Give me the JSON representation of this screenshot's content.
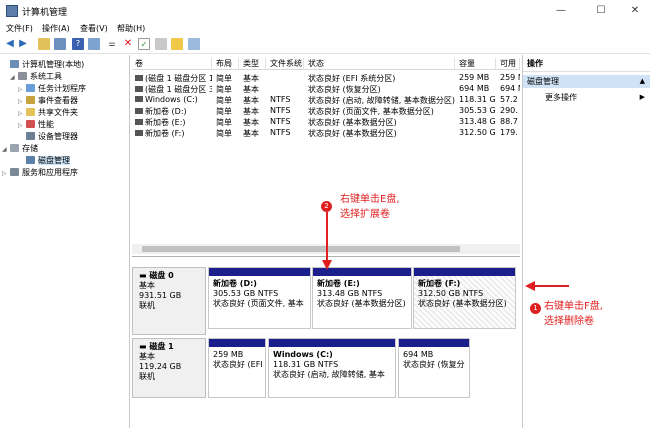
{
  "window": {
    "title": "计算机管理",
    "controls": {
      "minimize": "—",
      "maximize": "☐",
      "close": "✕"
    }
  },
  "menu": [
    "文件(F)",
    "操作(A)",
    "查看(V)",
    "帮助(H)"
  ],
  "tree": {
    "root": "计算机管理(本地)",
    "system_tools": "系统工具",
    "task_scheduler": "任务计划程序",
    "event_viewer": "事件查看器",
    "shared_folders": "共享文件夹",
    "performance": "性能",
    "device_manager": "设备管理器",
    "storage": "存储",
    "disk_management": "磁盘管理",
    "services": "服务和应用程序"
  },
  "columns": [
    "卷",
    "布局",
    "类型",
    "文件系统",
    "状态",
    "容量",
    "可用"
  ],
  "volumes": [
    {
      "name": "(磁盘 1 磁盘分区 1)",
      "layout": "简单",
      "type": "基本",
      "fs": "",
      "status": "状态良好 (EFI 系统分区)",
      "cap": "259 MB",
      "free": "259 MB"
    },
    {
      "name": "(磁盘 1 磁盘分区 3)",
      "layout": "简单",
      "type": "基本",
      "fs": "",
      "status": "状态良好 (恢复分区)",
      "cap": "694 MB",
      "free": "694 MB"
    },
    {
      "name": "Windows (C:)",
      "layout": "简单",
      "type": "基本",
      "fs": "NTFS",
      "status": "状态良好 (启动, 故障转储, 基本数据分区)",
      "cap": "118.31 GB",
      "free": "57.2"
    },
    {
      "name": "新加卷 (D:)",
      "layout": "简单",
      "type": "基本",
      "fs": "NTFS",
      "status": "状态良好 (页面文件, 基本数据分区)",
      "cap": "305.53 GB",
      "free": "290."
    },
    {
      "name": "新加卷 (E:)",
      "layout": "简单",
      "type": "基本",
      "fs": "NTFS",
      "status": "状态良好 (基本数据分区)",
      "cap": "313.48 GB",
      "free": "88.7"
    },
    {
      "name": "新加卷 (F:)",
      "layout": "简单",
      "type": "基本",
      "fs": "NTFS",
      "status": "状态良好 (基本数据分区)",
      "cap": "312.50 GB",
      "free": "179."
    }
  ],
  "disks": [
    {
      "name": "磁盘 0",
      "type": "基本",
      "size": "931.51 GB",
      "state": "联机",
      "partitions": [
        {
          "name": "新加卷 (D:)",
          "size": "305.53 GB NTFS",
          "status": "状态良好 (页面文件, 基本"
        },
        {
          "name": "新加卷 (E:)",
          "size": "313.48 GB NTFS",
          "status": "状态良好 (基本数据分区)"
        },
        {
          "name": "新加卷 (F:)",
          "size": "312.50 GB NTFS",
          "status": "状态良好 (基本数据分区)"
        }
      ]
    },
    {
      "name": "磁盘 1",
      "type": "基本",
      "size": "119.24 GB",
      "state": "联机",
      "partitions": [
        {
          "name": "",
          "size": "259 MB",
          "status": "状态良好 (EFI )"
        },
        {
          "name": "Windows (C:)",
          "size": "118.31 GB NTFS",
          "status": "状态良好 (启动, 故障转储, 基本"
        },
        {
          "name": "",
          "size": "694 MB",
          "status": "状态良好 (恢复分"
        }
      ]
    }
  ],
  "actions": {
    "header": "操作",
    "selected": "磁盘管理",
    "more": "更多操作"
  },
  "annotations": {
    "step2_line1": "右键单击E盘,",
    "step2_line2": "选择扩展卷",
    "step2_badge": "2",
    "step1_line1": "右键单击F盘,",
    "step1_line2": "选择删除卷",
    "step1_badge": "1",
    "annotation_color": "#e02020"
  }
}
